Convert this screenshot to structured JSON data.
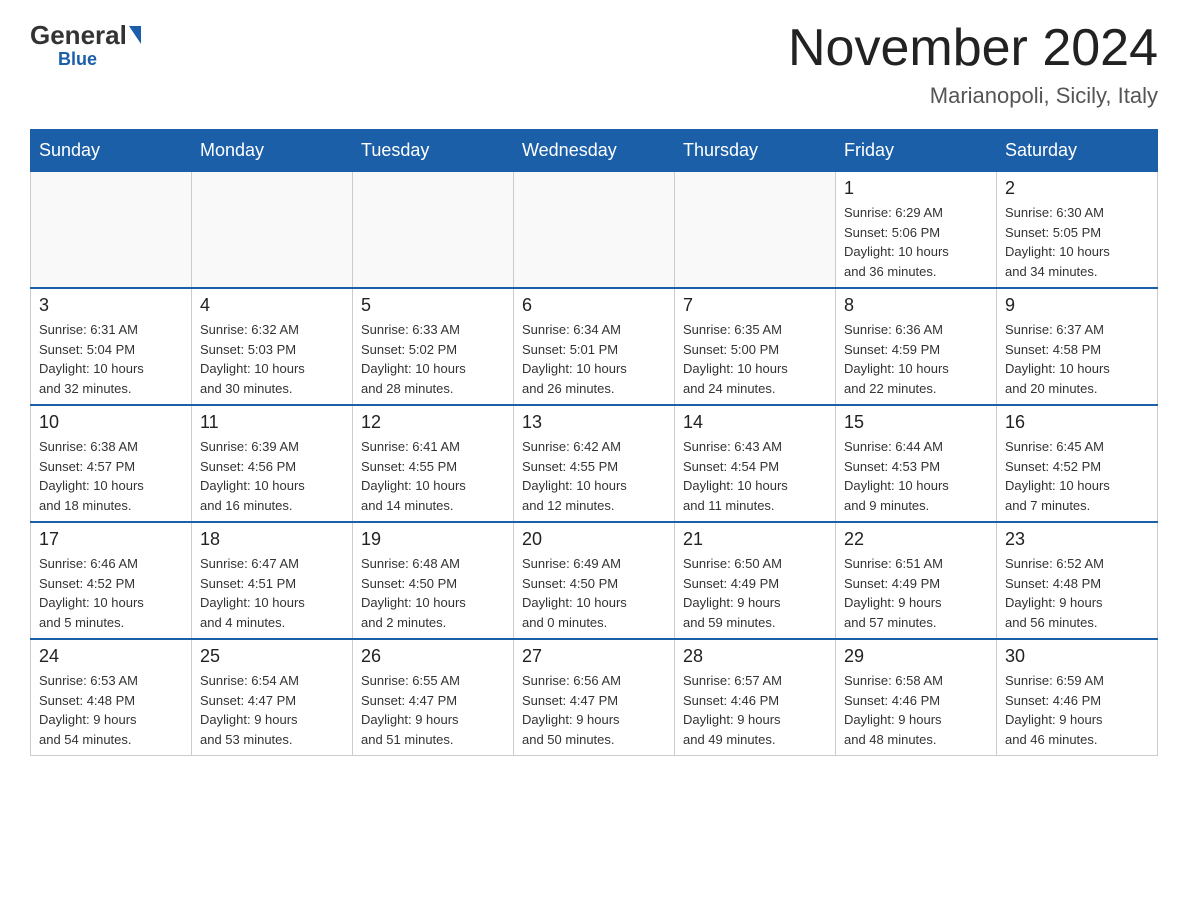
{
  "header": {
    "logo_general": "General",
    "logo_blue": "Blue",
    "title": "November 2024",
    "subtitle": "Marianopoli, Sicily, Italy"
  },
  "weekdays": [
    "Sunday",
    "Monday",
    "Tuesday",
    "Wednesday",
    "Thursday",
    "Friday",
    "Saturday"
  ],
  "weeks": [
    [
      {
        "day": "",
        "info": ""
      },
      {
        "day": "",
        "info": ""
      },
      {
        "day": "",
        "info": ""
      },
      {
        "day": "",
        "info": ""
      },
      {
        "day": "",
        "info": ""
      },
      {
        "day": "1",
        "info": "Sunrise: 6:29 AM\nSunset: 5:06 PM\nDaylight: 10 hours\nand 36 minutes."
      },
      {
        "day": "2",
        "info": "Sunrise: 6:30 AM\nSunset: 5:05 PM\nDaylight: 10 hours\nand 34 minutes."
      }
    ],
    [
      {
        "day": "3",
        "info": "Sunrise: 6:31 AM\nSunset: 5:04 PM\nDaylight: 10 hours\nand 32 minutes."
      },
      {
        "day": "4",
        "info": "Sunrise: 6:32 AM\nSunset: 5:03 PM\nDaylight: 10 hours\nand 30 minutes."
      },
      {
        "day": "5",
        "info": "Sunrise: 6:33 AM\nSunset: 5:02 PM\nDaylight: 10 hours\nand 28 minutes."
      },
      {
        "day": "6",
        "info": "Sunrise: 6:34 AM\nSunset: 5:01 PM\nDaylight: 10 hours\nand 26 minutes."
      },
      {
        "day": "7",
        "info": "Sunrise: 6:35 AM\nSunset: 5:00 PM\nDaylight: 10 hours\nand 24 minutes."
      },
      {
        "day": "8",
        "info": "Sunrise: 6:36 AM\nSunset: 4:59 PM\nDaylight: 10 hours\nand 22 minutes."
      },
      {
        "day": "9",
        "info": "Sunrise: 6:37 AM\nSunset: 4:58 PM\nDaylight: 10 hours\nand 20 minutes."
      }
    ],
    [
      {
        "day": "10",
        "info": "Sunrise: 6:38 AM\nSunset: 4:57 PM\nDaylight: 10 hours\nand 18 minutes."
      },
      {
        "day": "11",
        "info": "Sunrise: 6:39 AM\nSunset: 4:56 PM\nDaylight: 10 hours\nand 16 minutes."
      },
      {
        "day": "12",
        "info": "Sunrise: 6:41 AM\nSunset: 4:55 PM\nDaylight: 10 hours\nand 14 minutes."
      },
      {
        "day": "13",
        "info": "Sunrise: 6:42 AM\nSunset: 4:55 PM\nDaylight: 10 hours\nand 12 minutes."
      },
      {
        "day": "14",
        "info": "Sunrise: 6:43 AM\nSunset: 4:54 PM\nDaylight: 10 hours\nand 11 minutes."
      },
      {
        "day": "15",
        "info": "Sunrise: 6:44 AM\nSunset: 4:53 PM\nDaylight: 10 hours\nand 9 minutes."
      },
      {
        "day": "16",
        "info": "Sunrise: 6:45 AM\nSunset: 4:52 PM\nDaylight: 10 hours\nand 7 minutes."
      }
    ],
    [
      {
        "day": "17",
        "info": "Sunrise: 6:46 AM\nSunset: 4:52 PM\nDaylight: 10 hours\nand 5 minutes."
      },
      {
        "day": "18",
        "info": "Sunrise: 6:47 AM\nSunset: 4:51 PM\nDaylight: 10 hours\nand 4 minutes."
      },
      {
        "day": "19",
        "info": "Sunrise: 6:48 AM\nSunset: 4:50 PM\nDaylight: 10 hours\nand 2 minutes."
      },
      {
        "day": "20",
        "info": "Sunrise: 6:49 AM\nSunset: 4:50 PM\nDaylight: 10 hours\nand 0 minutes."
      },
      {
        "day": "21",
        "info": "Sunrise: 6:50 AM\nSunset: 4:49 PM\nDaylight: 9 hours\nand 59 minutes."
      },
      {
        "day": "22",
        "info": "Sunrise: 6:51 AM\nSunset: 4:49 PM\nDaylight: 9 hours\nand 57 minutes."
      },
      {
        "day": "23",
        "info": "Sunrise: 6:52 AM\nSunset: 4:48 PM\nDaylight: 9 hours\nand 56 minutes."
      }
    ],
    [
      {
        "day": "24",
        "info": "Sunrise: 6:53 AM\nSunset: 4:48 PM\nDaylight: 9 hours\nand 54 minutes."
      },
      {
        "day": "25",
        "info": "Sunrise: 6:54 AM\nSunset: 4:47 PM\nDaylight: 9 hours\nand 53 minutes."
      },
      {
        "day": "26",
        "info": "Sunrise: 6:55 AM\nSunset: 4:47 PM\nDaylight: 9 hours\nand 51 minutes."
      },
      {
        "day": "27",
        "info": "Sunrise: 6:56 AM\nSunset: 4:47 PM\nDaylight: 9 hours\nand 50 minutes."
      },
      {
        "day": "28",
        "info": "Sunrise: 6:57 AM\nSunset: 4:46 PM\nDaylight: 9 hours\nand 49 minutes."
      },
      {
        "day": "29",
        "info": "Sunrise: 6:58 AM\nSunset: 4:46 PM\nDaylight: 9 hours\nand 48 minutes."
      },
      {
        "day": "30",
        "info": "Sunrise: 6:59 AM\nSunset: 4:46 PM\nDaylight: 9 hours\nand 46 minutes."
      }
    ]
  ]
}
